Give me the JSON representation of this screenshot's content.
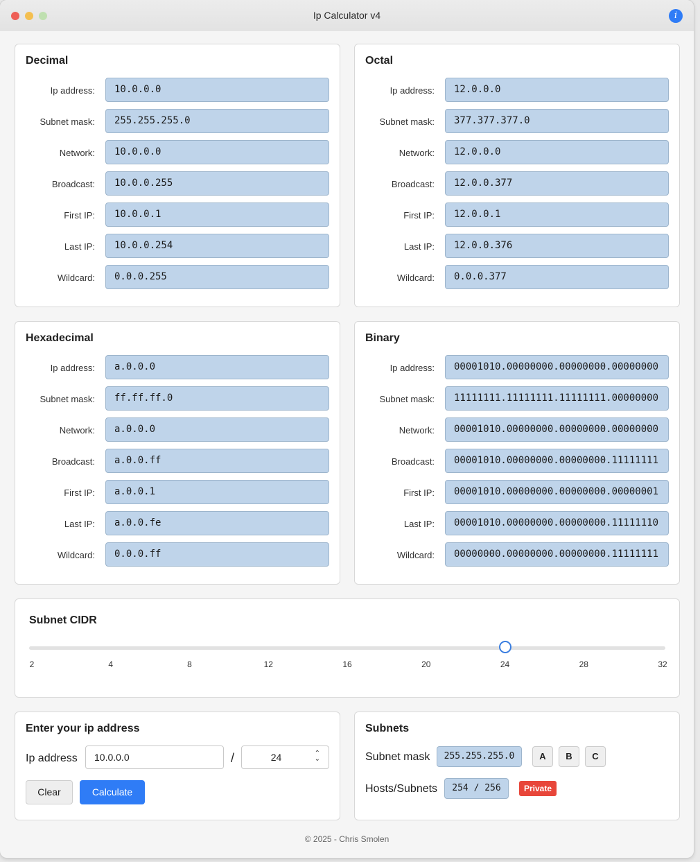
{
  "window": {
    "title": "Ip Calculator v4",
    "info_icon": "i"
  },
  "labels": [
    "Ip address:",
    "Subnet mask:",
    "Network:",
    "Broadcast:",
    "First IP:",
    "Last IP:",
    "Wildcard:"
  ],
  "decimal": {
    "title": "Decimal",
    "values": [
      "10.0.0.0",
      "255.255.255.0",
      "10.0.0.0",
      "10.0.0.255",
      "10.0.0.1",
      "10.0.0.254",
      "0.0.0.255"
    ]
  },
  "octal": {
    "title": "Octal",
    "values": [
      "12.0.0.0",
      "377.377.377.0",
      "12.0.0.0",
      "12.0.0.377",
      "12.0.0.1",
      "12.0.0.376",
      "0.0.0.377"
    ]
  },
  "hexadecimal": {
    "title": "Hexadecimal",
    "values": [
      "a.0.0.0",
      "ff.ff.ff.0",
      "a.0.0.0",
      "a.0.0.ff",
      "a.0.0.1",
      "a.0.0.fe",
      "0.0.0.ff"
    ]
  },
  "binary": {
    "title": "Binary",
    "values": [
      "00001010.00000000.00000000.00000000",
      "11111111.11111111.11111111.00000000",
      "00001010.00000000.00000000.00000000",
      "00001010.00000000.00000000.11111111",
      "00001010.00000000.00000000.00000001",
      "00001010.00000000.00000000.11111110",
      "00000000.00000000.00000000.11111111"
    ]
  },
  "cidr": {
    "title": "Subnet CIDR",
    "min": 2,
    "max": 32,
    "value": 24,
    "ticks": [
      "2",
      "4",
      "8",
      "12",
      "16",
      "20",
      "24",
      "28",
      "32"
    ]
  },
  "entry": {
    "title": "Enter your ip address",
    "ip_label": "Ip address",
    "ip_value": "10.0.0.0",
    "slash": "/",
    "prefix_value": "24",
    "clear_label": "Clear",
    "calculate_label": "Calculate"
  },
  "subnets": {
    "title": "Subnets",
    "mask_label": "Subnet mask",
    "mask_value": "255.255.255.0",
    "class_buttons": [
      "A",
      "B",
      "C"
    ],
    "hosts_label": "Hosts/Subnets",
    "hosts_value": "254 / 256",
    "badge": "Private",
    "badge_color": "#e8463a"
  },
  "footer": "© 2025 - Chris Smolen",
  "colors": {
    "accent": "#2f7cf6",
    "field_bg": "#bfd4ea"
  }
}
